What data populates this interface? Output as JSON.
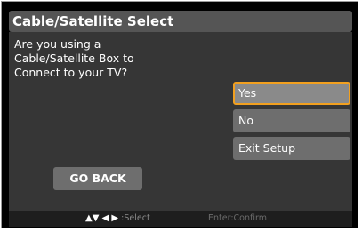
{
  "title": "Cable/Satellite Select",
  "question": "Are you using a\nCable/Satellite Box to\nConnect to your TV?",
  "options": [
    {
      "label": "Yes",
      "selected": true
    },
    {
      "label": "No",
      "selected": false
    },
    {
      "label": "Exit Setup",
      "selected": false
    }
  ],
  "go_back_label": "GO BACK",
  "footer": {
    "nav_arrows": "▲▼ ◀ ▶",
    "nav_hint": ":Select",
    "confirm_hint": "Enter:Confirm"
  },
  "colors": {
    "selection_border": "#f2a01f",
    "panel": "#363636",
    "button": "#6e6e6e"
  }
}
